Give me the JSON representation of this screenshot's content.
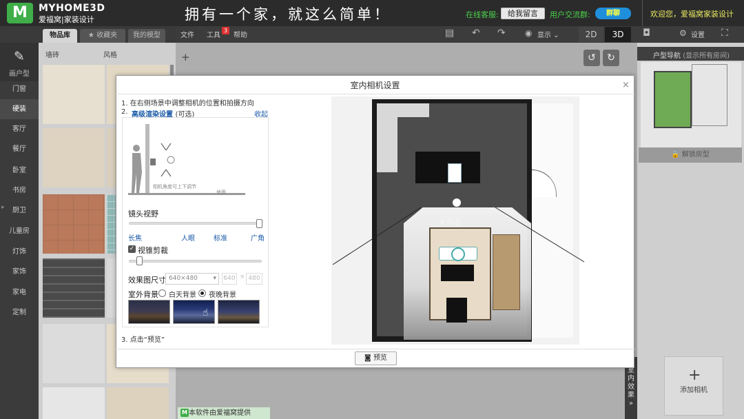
{
  "header": {
    "logo_mark": "M",
    "brand_name": "MYHOME3D",
    "brand_sub": "爱福窝|家装设计",
    "slogan": "拥有一个家，就这么简单！",
    "service_label": "在线客服:",
    "service_button": "给我留言",
    "group_label": "用户交流群:",
    "group_button": "群聊",
    "welcome": "欢迎您，爱福窝家装设计"
  },
  "panel_tabs": [
    "物品库",
    "★ 收藏夹",
    "我的模型"
  ],
  "menu": {
    "file": "文件",
    "tools": "工具",
    "tools_badge": "3",
    "help": "帮助"
  },
  "toolbar": {
    "view": "显示 ⌄",
    "btn_2d": "2D",
    "btn_3d": "3D",
    "settings": "设置"
  },
  "sidebar": {
    "draw_room": "画户型",
    "items": [
      "门窗",
      "硬装",
      "客厅",
      "餐厅",
      "卧室",
      "书房",
      "厨卫",
      "儿童房",
      "灯饰",
      "家饰",
      "家电",
      "定制"
    ],
    "active_index": 1
  },
  "filters": {
    "tile": "墙砖",
    "style": "风格"
  },
  "watermark": "本软件由爱福窝提供",
  "right_panel": {
    "title": "户型导航",
    "subtitle": "(显示所有房间)",
    "lock": "解锁房型",
    "add_camera": "添加相机",
    "effect_tab": "室内效果 »"
  },
  "dialog": {
    "title": "室内相机设置",
    "close": "×",
    "step1": "1.  在右侧场景中调整相机的位置和拍摄方向",
    "step2_prefix": "2.",
    "step2_link": "高级渲染设置",
    "step2_suffix": "(可选)",
    "collapse": "收起",
    "illus_note": "相机角度可上下调节",
    "illus_floor": "地面",
    "fov_title": "镜头视野",
    "fov_labels": [
      "长焦",
      "人眼",
      "标准",
      "广角"
    ],
    "fov_value": 1.0,
    "clip_label": "视锥剪裁",
    "clip_checked": true,
    "clip_value": 0.08,
    "size_label": "效果图尺寸",
    "size_value": "640×480",
    "size_w": "640",
    "size_x": "×",
    "size_h": "480",
    "bg_label": "室外背景",
    "bg_day": "白天背景",
    "bg_night": "夜晚背景",
    "bg_selected": "night",
    "step3": "3.  点击“预览”",
    "preview_button": "预览"
  },
  "plan": {
    "camera_name": "未命名"
  },
  "colors": {
    "brand_green": "#3fae49",
    "link_blue": "#1a5aa8",
    "topbar": "#2b2b2b"
  }
}
